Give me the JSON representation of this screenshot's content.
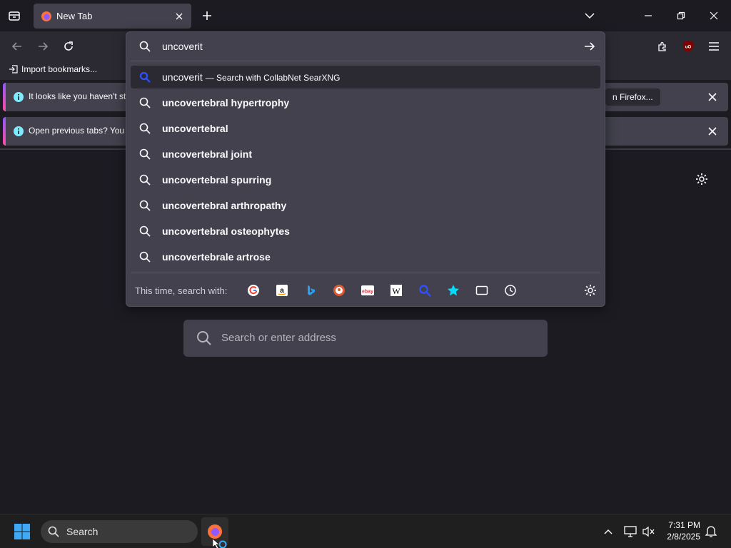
{
  "tab": {
    "title": "New Tab"
  },
  "bookmarks": {
    "import_label": "Import bookmarks..."
  },
  "notifications": [
    {
      "message": "It looks like you haven't st",
      "button_label": "n Firefox..."
    },
    {
      "message": "Open previous tabs? You c"
    }
  ],
  "urlbar": {
    "value": "uncoverit",
    "selected_result": {
      "query": "uncoverit",
      "suffix": "— Search with CollabNet SearXNG"
    },
    "suggestions": [
      "uncovertebral hypertrophy",
      "uncovertebral",
      "uncovertebral joint",
      "uncovertebral spurring",
      "uncovertebral arthropathy",
      "uncovertebral osteophytes",
      "uncovertebrale artrose"
    ],
    "oneoff_label": "This time, search with:",
    "engines": [
      {
        "name": "google-icon"
      },
      {
        "name": "amazon-icon"
      },
      {
        "name": "bing-icon"
      },
      {
        "name": "duckduckgo-icon"
      },
      {
        "name": "ebay-icon"
      },
      {
        "name": "wikipedia-icon"
      },
      {
        "name": "searxng-icon"
      },
      {
        "name": "bookmarks-icon"
      },
      {
        "name": "tabs-icon"
      },
      {
        "name": "history-icon"
      }
    ]
  },
  "ntp": {
    "search_placeholder": "Search or enter address"
  },
  "taskbar": {
    "search_label": "Search",
    "time": "7:31 PM",
    "date": "2/8/2025"
  },
  "colors": {
    "accent": "#9059ff",
    "panel": "#42414d",
    "toolbar": "#2b2a33",
    "page_bg": "#1c1b22"
  }
}
